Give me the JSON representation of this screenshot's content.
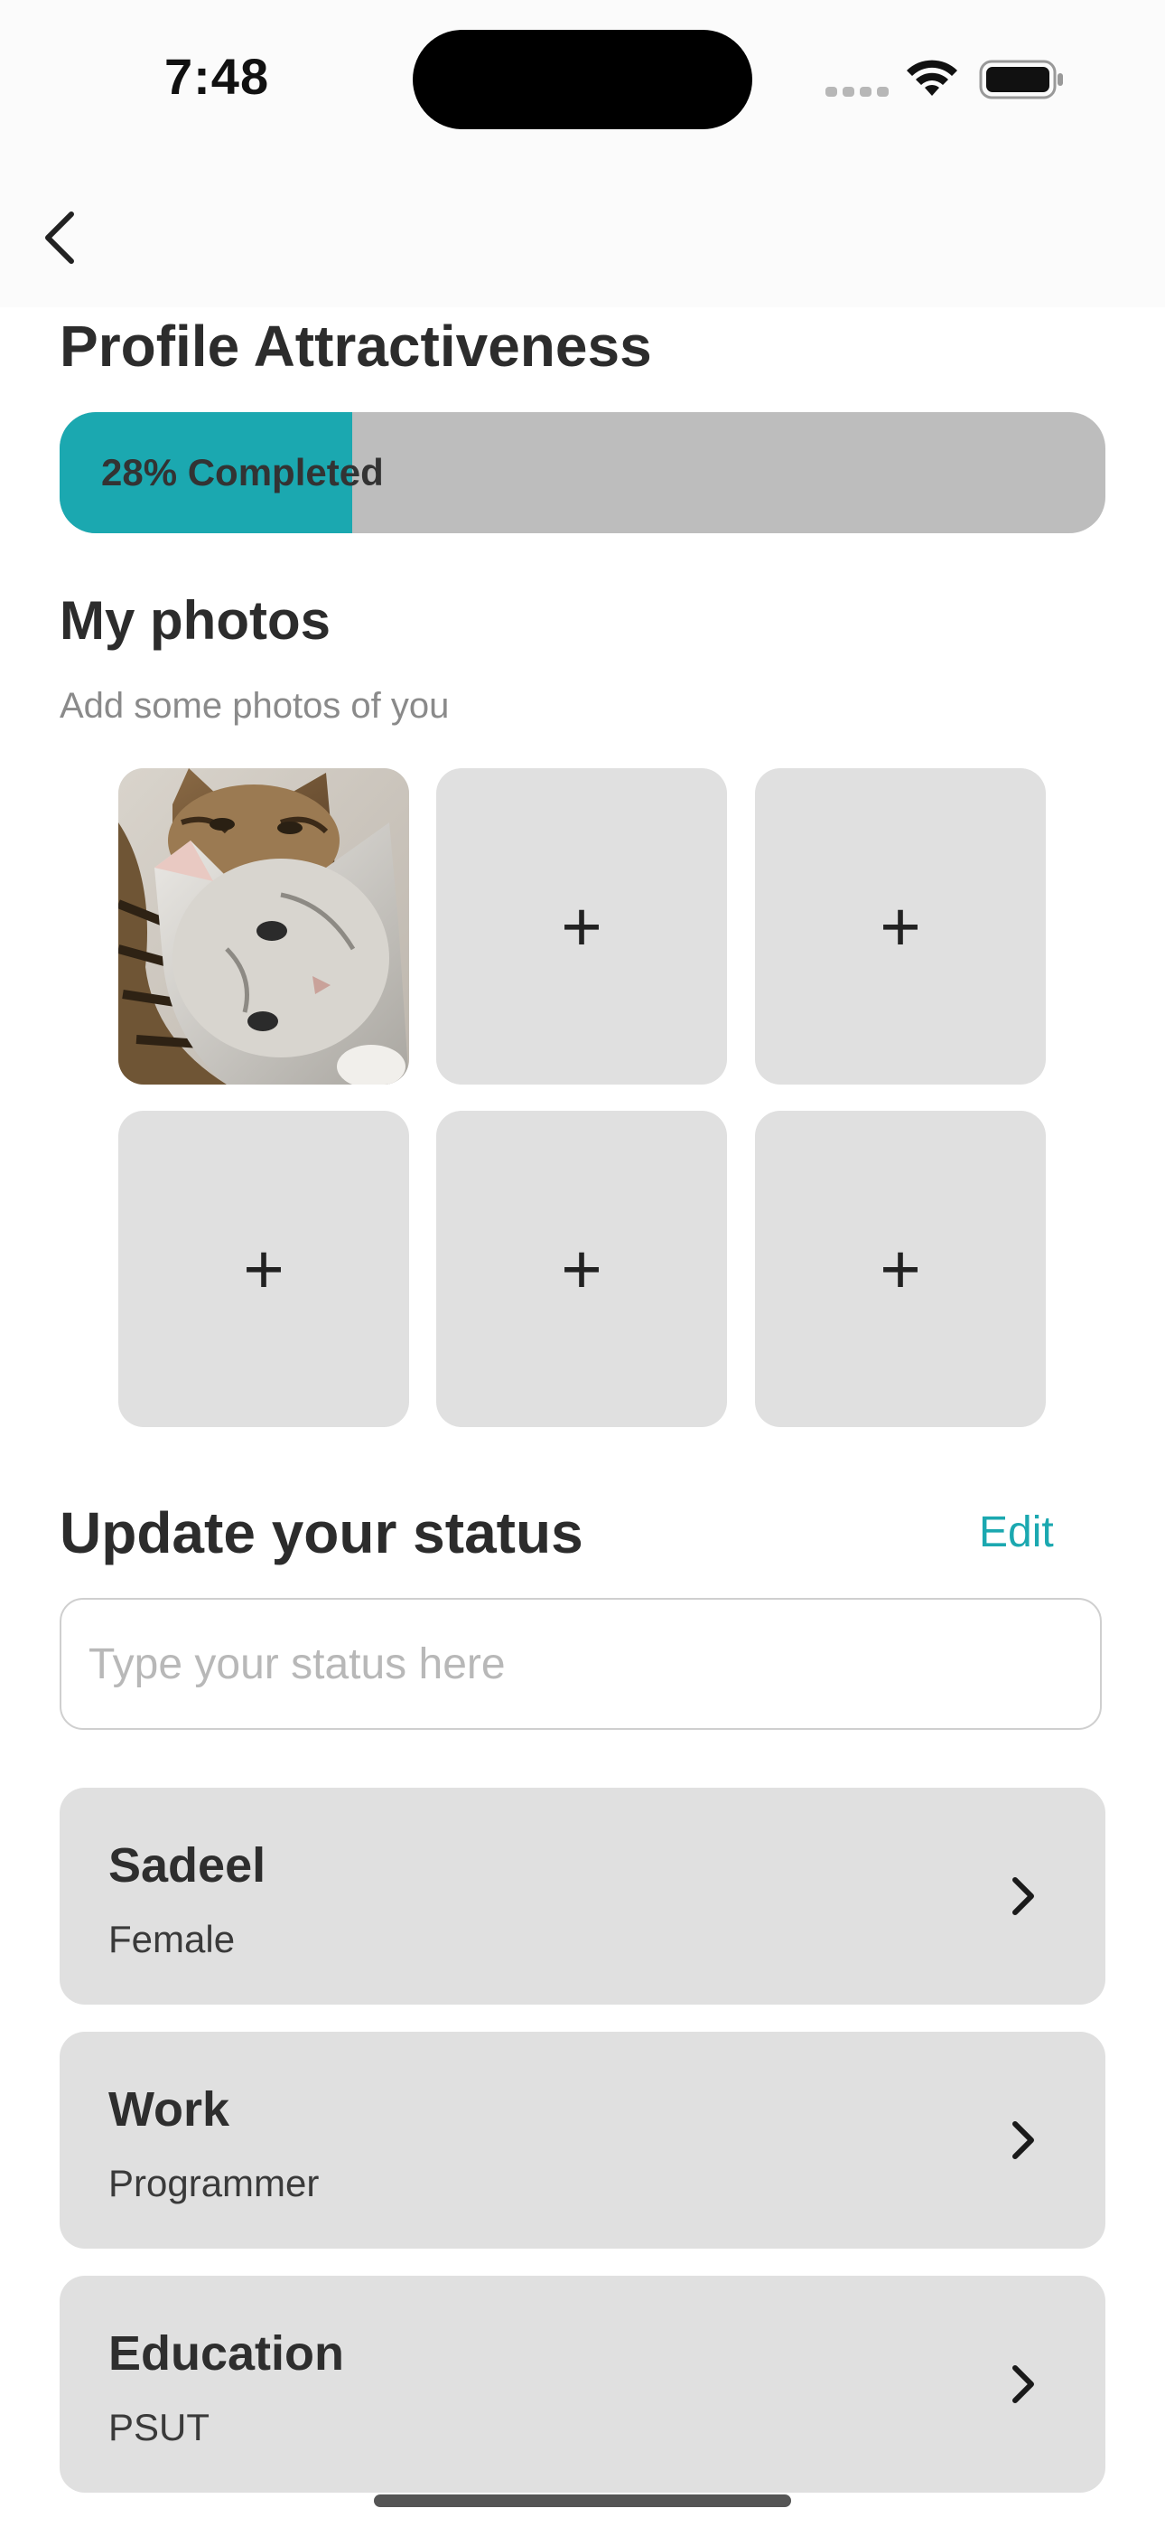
{
  "status_bar": {
    "time": "7:48"
  },
  "nav": {
    "back_icon": "chevron-left-icon"
  },
  "profile": {
    "title": "Profile Attractiveness",
    "progress_percent": 28,
    "progress_label": "28% Completed",
    "accent_color": "#1ba8b0"
  },
  "photos": {
    "title": "My photos",
    "subtitle": "Add some photos of you",
    "slots": [
      {
        "filled": true,
        "image": "kittens-photo"
      },
      {
        "filled": false,
        "icon": "plus-icon",
        "label": "+"
      },
      {
        "filled": false,
        "icon": "plus-icon",
        "label": "+"
      },
      {
        "filled": false,
        "icon": "plus-icon",
        "label": "+"
      },
      {
        "filled": false,
        "icon": "plus-icon",
        "label": "+"
      },
      {
        "filled": false,
        "icon": "plus-icon",
        "label": "+"
      }
    ]
  },
  "status": {
    "title": "Update your status",
    "edit_label": "Edit",
    "placeholder": "Type your status here",
    "value": ""
  },
  "cards": [
    {
      "title": "Sadeel",
      "value": "Female"
    },
    {
      "title": "Work",
      "value": "Programmer"
    },
    {
      "title": "Education",
      "value": "PSUT"
    }
  ]
}
